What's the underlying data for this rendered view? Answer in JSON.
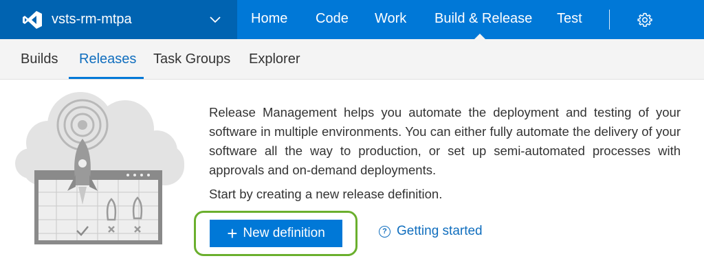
{
  "header": {
    "project_name": "vsts-rm-mtpa",
    "nav": [
      "Home",
      "Code",
      "Work",
      "Build & Release",
      "Test"
    ],
    "active_nav": "Build & Release",
    "brand_color": "#0078d7"
  },
  "subnav": {
    "tabs": [
      "Builds",
      "Releases",
      "Task Groups",
      "Explorer"
    ],
    "active_tab": "Releases"
  },
  "main": {
    "description": "Release Management helps you automate the deployment and testing of your software in multiple environments. You can either fully automate the delivery of your software all the way to production, or set up semi-automated processes with approvals and on-demand deployments.",
    "start_text": "Start by creating a new release definition.",
    "new_definition_label": "New definition",
    "getting_started_label": "Getting started",
    "highlight_color": "#6aaf2d"
  },
  "icons": [
    "visual-studio-logo-icon",
    "chevron-down-icon",
    "gear-icon",
    "plus-icon",
    "question-circle-icon",
    "release-rocket-illustration"
  ]
}
